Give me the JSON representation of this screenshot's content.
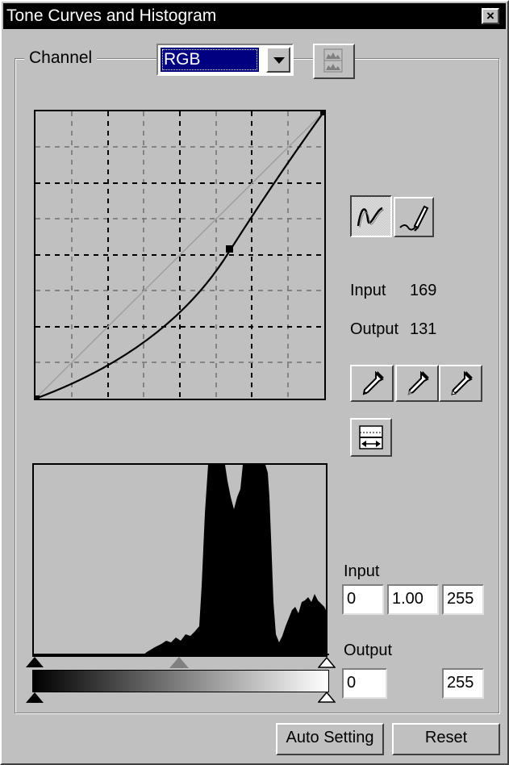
{
  "window": {
    "title": "Tone Curves and Histogram",
    "close_glyph": "×"
  },
  "channel": {
    "label": "Channel",
    "selected": "RGB"
  },
  "readout": {
    "input_label": "Input",
    "input_value": "169",
    "output_label": "Output",
    "output_value": "131"
  },
  "levels": {
    "input_label": "Input",
    "input_black": "0",
    "input_gamma": "1.00",
    "input_white": "255",
    "output_label": "Output",
    "output_black": "0",
    "output_white": "255"
  },
  "buttons": {
    "auto_setting": "Auto Setting",
    "reset": "Reset"
  },
  "icons": [
    "display-toggle-icon",
    "curve-tool-icon",
    "freehand-tool-icon",
    "black-eyedropper-icon",
    "gray-eyedropper-icon",
    "white-eyedropper-icon",
    "reverse-curve-icon"
  ]
}
